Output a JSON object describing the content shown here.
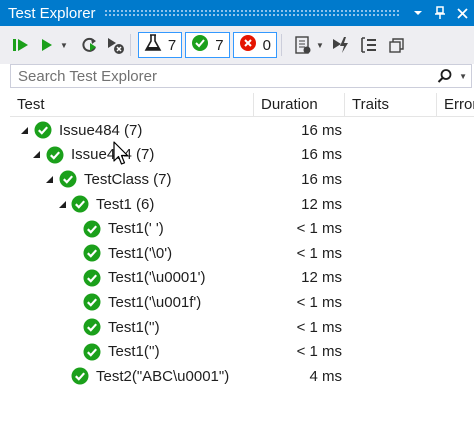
{
  "window": {
    "title": "Test Explorer",
    "pin_icon": "pin-icon",
    "close_icon": "close-icon",
    "dropdown_icon": "chevron-down-icon"
  },
  "toolbar": {
    "run_all_icon": "run-all-icon",
    "run_icon": "run-icon",
    "refresh_icon": "refresh-icon",
    "cancel_icon": "cancel-icon",
    "flask_count": "7",
    "passed_count": "7",
    "failed_count": "0",
    "playlist_icon": "playlist-icon",
    "run_after_build_icon": "run-after-build-icon",
    "group_icon": "group-by-icon",
    "collapse_icon": "collapse-icon"
  },
  "search": {
    "placeholder": "Search Test Explorer"
  },
  "columns": {
    "test": "Test",
    "duration": "Duration",
    "traits": "Traits",
    "error": "Error"
  },
  "tests": [
    {
      "name": "Issue484 (7)",
      "duration": "16 ms",
      "expanded": true,
      "status": "passed"
    },
    {
      "name": "Issue484 (7)",
      "duration": "16 ms",
      "expanded": true,
      "status": "passed"
    },
    {
      "name": "TestClass (7)",
      "duration": "16 ms",
      "expanded": true,
      "status": "passed"
    },
    {
      "name": "Test1 (6)",
      "duration": "12 ms",
      "expanded": true,
      "status": "passed"
    },
    {
      "name": "Test1(' ')",
      "duration": "< 1 ms",
      "status": "passed"
    },
    {
      "name": "Test1('\\0')",
      "duration": "< 1 ms",
      "status": "passed"
    },
    {
      "name": "Test1('\\u0001')",
      "duration": "12 ms",
      "status": "passed"
    },
    {
      "name": "Test1('\\u001f')",
      "duration": "< 1 ms",
      "status": "passed"
    },
    {
      "name": "Test1('')",
      "duration": "< 1 ms",
      "status": "passed"
    },
    {
      "name": "Test1('')",
      "duration": "< 1 ms",
      "status": "passed"
    },
    {
      "name": "Test2(\"ABC\\u0001\")",
      "duration": "4 ms",
      "status": "passed"
    }
  ],
  "colors": {
    "accent": "#007acc",
    "pass": "#1ba01b",
    "fail": "#e51400"
  }
}
